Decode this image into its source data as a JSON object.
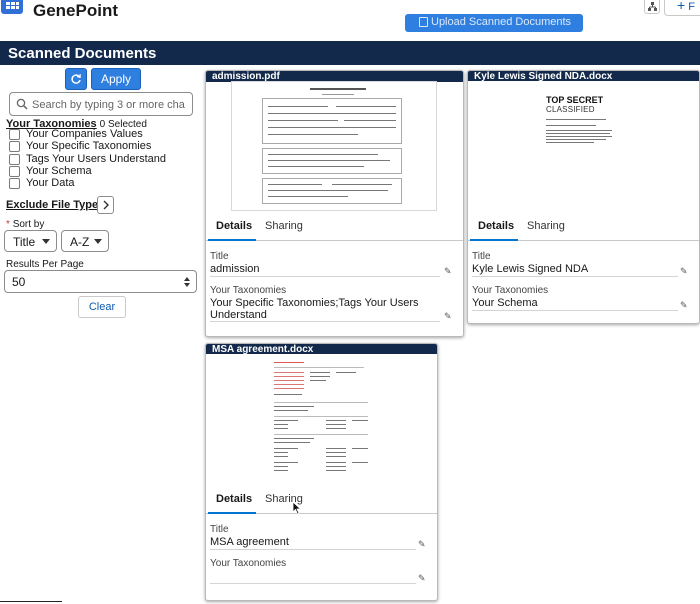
{
  "app": {
    "title": "GenePoint",
    "upload_button": "Upload Scanned Documents",
    "new_button": "+",
    "new_label": "F"
  },
  "section": {
    "title": "Scanned Documents"
  },
  "sidebar": {
    "apply_label": "Apply",
    "search_placeholder": "Search by typing 3 or more cha",
    "taxonomies_label": "Your Taxonomies",
    "selected_count": "0 Selected",
    "taxonomy_options": [
      "Your Companies Values",
      "Your Specific Taxonomies",
      "Tags Your Users Understand",
      "Your Schema",
      "Your Data"
    ],
    "exclude_label": "Exclude File Types:",
    "sort_by_label": "Sort by",
    "sort_required_mark": "*",
    "sort_field": "Title",
    "sort_order": "A-Z",
    "results_per_page_label": "Results Per Page",
    "results_per_page": "50",
    "clear_label": "Clear"
  },
  "documents": [
    {
      "file_name": "admission.pdf",
      "tabs": [
        "Details",
        "Sharing"
      ],
      "title_label": "Title",
      "title": "admission",
      "taxonomies_label": "Your Taxonomies",
      "taxonomies": "Your Specific Taxonomies;Tags Your Users Understand"
    },
    {
      "file_name": "Kyle Lewis Signed NDA.docx",
      "tabs": [
        "Details",
        "Sharing"
      ],
      "title_label": "Title",
      "title": "Kyle Lewis Signed NDA",
      "taxonomies_label": "Your Taxonomies",
      "taxonomies": "Your Schema",
      "preview_heading": "TOP SECRET",
      "preview_subheading": "CLASSIFIED"
    },
    {
      "file_name": "MSA agreement.docx",
      "tabs": [
        "Details",
        "Sharing"
      ],
      "title_label": "Title",
      "title": "MSA agreement",
      "taxonomies_label": "Your Taxonomies",
      "taxonomies": ""
    }
  ],
  "colors": {
    "brand_blue": "#2f7fe0",
    "title_bar": "#13294b",
    "tab_underline": "#0176d3",
    "link_blue": "#0b5cab"
  },
  "icons": {
    "app": "app-grid-icon",
    "refresh": "refresh-icon",
    "search": "search-icon",
    "chevron": "chevron-right-icon",
    "edit": "pencil-icon",
    "hierarchy": "hierarchy-icon"
  }
}
